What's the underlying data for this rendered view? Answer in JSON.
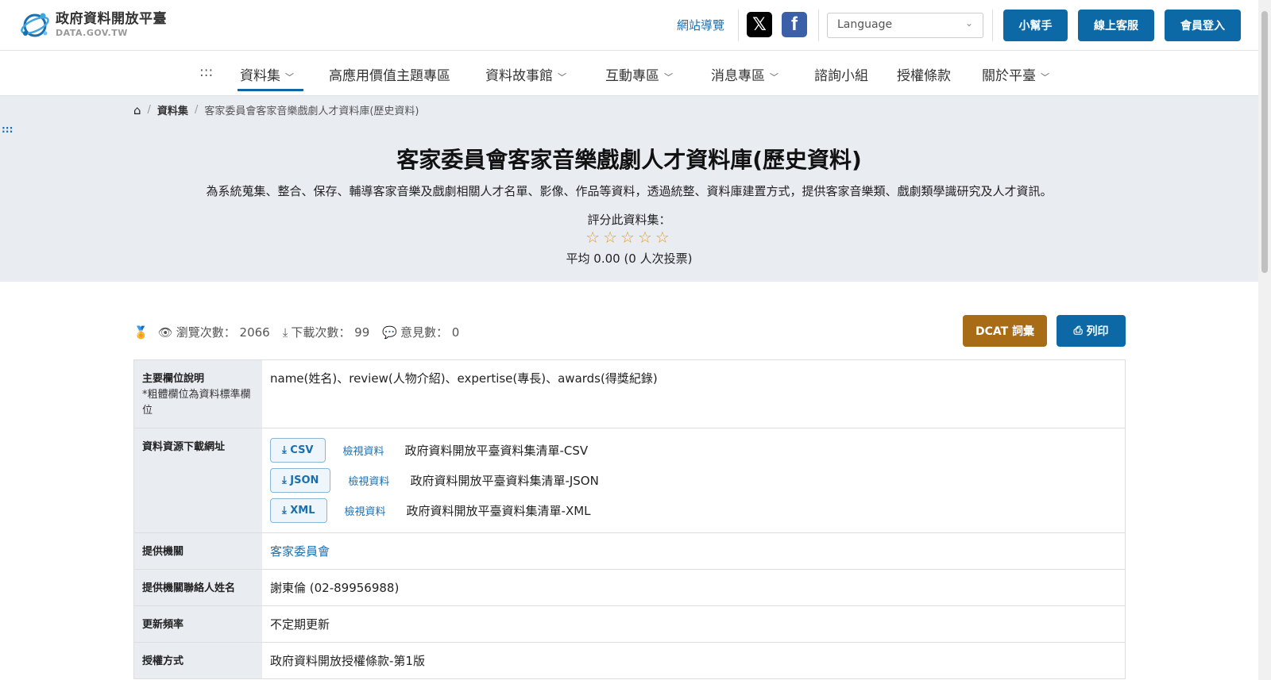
{
  "header": {
    "logo_title": "政府資料開放平臺",
    "logo_sub": "DATA.GOV.TW",
    "site_nav_label": "網站導覽",
    "language_placeholder": "Language",
    "helper_label": "小幫手",
    "support_label": "線上客服",
    "login_label": "會員登入"
  },
  "mainnav": {
    "dots": ":::",
    "items": [
      {
        "label": "資料集"
      },
      {
        "label": "高應用價值主題專區"
      },
      {
        "label": "資料故事館"
      },
      {
        "label": "互動專區"
      },
      {
        "label": "消息專區"
      },
      {
        "label": "諮詢小組"
      },
      {
        "label": "授權條款"
      },
      {
        "label": "關於平臺"
      }
    ]
  },
  "breadcrumb": {
    "items": [
      "資料集",
      "客家委員會客家音樂戲劇人才資料庫(歷史資料)"
    ]
  },
  "hero": {
    "dots": ":::",
    "title": "客家委員會客家音樂戲劇人才資料庫(歷史資料)",
    "description": "為系統蒐集、整合、保存、輔導客家音樂及戲劇相關人才名單、影像、作品等資料，透過統整、資料庫建置方式，提供客家音樂類、戲劇類學識研究及人才資訊。",
    "rate_label": "評分此資料集：",
    "stars": "☆☆☆☆☆",
    "average_text": "平均 0.00 (0 人次投票)"
  },
  "stats": {
    "views_label": "瀏覽次數：",
    "views": "2066",
    "downloads_label": "下載次數：",
    "downloads": "99",
    "comments_label": "意見數：",
    "comments": "0",
    "dcat_label": "DCAT 詞彙",
    "print_label": "列印"
  },
  "info": {
    "fields": {
      "label": "主要欄位說明",
      "note": "*粗體欄位為資料標準欄位",
      "value": "name(姓名)、review(人物介紹)、expertise(專長)、awards(得獎紀錄)"
    },
    "resources": {
      "label": "資料資源下載網址",
      "items": [
        {
          "format": "CSV",
          "view": "檢視資料",
          "name": "政府資料開放平臺資料集清單-CSV"
        },
        {
          "format": "JSON",
          "view": "檢視資料",
          "name": "政府資料開放平臺資料集清單-JSON"
        },
        {
          "format": "XML",
          "view": "檢視資料",
          "name": "政府資料開放平臺資料集清單-XML"
        }
      ]
    },
    "agency": {
      "label": "提供機關",
      "value": "客家委員會"
    },
    "contact": {
      "label": "提供機關聯絡人姓名",
      "value": "謝東倫 (02-89956988)"
    },
    "frequency": {
      "label": "更新頻率",
      "value": "不定期更新"
    },
    "license": {
      "label": "授權方式",
      "value": "政府資料開放授權條款-第1版"
    }
  }
}
